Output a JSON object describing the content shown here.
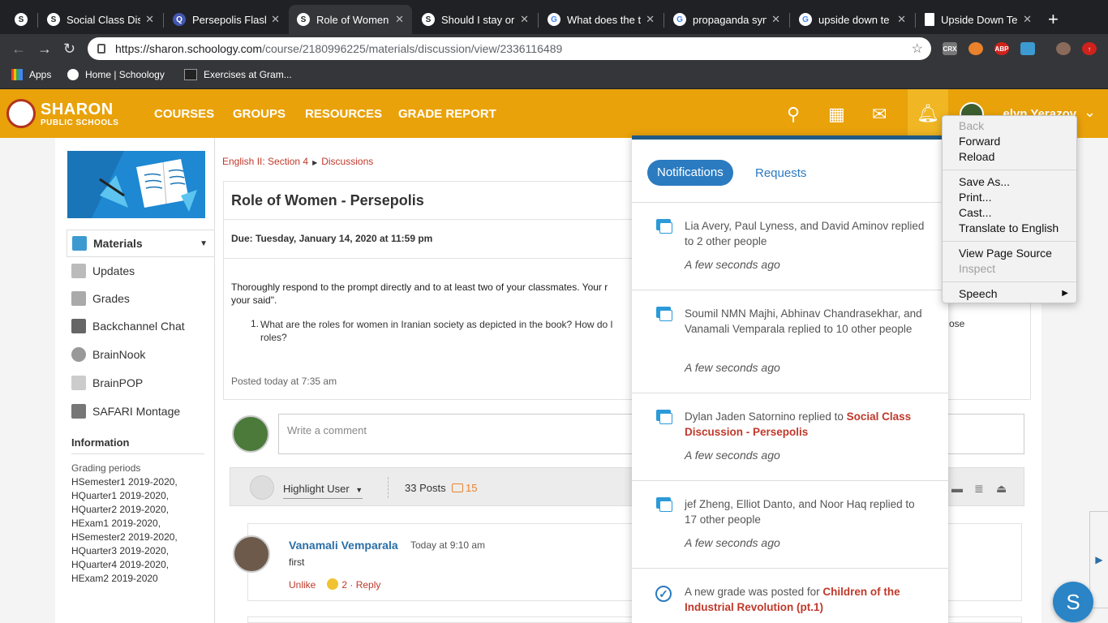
{
  "browser": {
    "tabs": [
      {
        "label": "",
        "icon": "schoology-icon",
        "active": false
      },
      {
        "label": "Social Class Dis",
        "icon": "schoology-icon",
        "active": false
      },
      {
        "label": "Persepolis Flash",
        "icon": "quizlet-icon",
        "active": false
      },
      {
        "label": "Role of Women",
        "icon": "schoology-icon",
        "active": true
      },
      {
        "label": "Should I stay or",
        "icon": "schoology-icon",
        "active": false
      },
      {
        "label": "What does the t",
        "icon": "google-icon",
        "active": false
      },
      {
        "label": "propaganda syn",
        "icon": "google-icon",
        "active": false
      },
      {
        "label": "upside down te",
        "icon": "google-icon",
        "active": false
      },
      {
        "label": "Upside Down Te",
        "icon": "document-icon",
        "active": false
      }
    ],
    "url_host": "https://sharon.schoology.com",
    "url_path": "/course/2180996225/materials/discussion/view/2336116489",
    "extensions": [
      "CRX",
      "ABP"
    ],
    "bookmarks": [
      {
        "label": "Apps"
      },
      {
        "label": "Home | Schoology"
      },
      {
        "label": "Exercises at Gram..."
      }
    ]
  },
  "header": {
    "logo_line1": "SHARON",
    "logo_line2": "PUBLIC SCHOOLS",
    "nav": [
      "COURSES",
      "GROUPS",
      "RESOURCES",
      "GRADE REPORT"
    ],
    "user_name": "...elyn Yerazov",
    "brand_color": "#e9a20a"
  },
  "sidebar": {
    "items": [
      {
        "label": "Materials",
        "selected": true
      },
      {
        "label": "Updates"
      },
      {
        "label": "Grades"
      },
      {
        "label": "Backchannel Chat"
      },
      {
        "label": "BrainNook"
      },
      {
        "label": "BrainPOP"
      },
      {
        "label": "SAFARI Montage"
      }
    ],
    "info_heading": "Information",
    "grading_label": "Grading periods",
    "grading_periods": "HSemester1 2019-2020,\nHQuarter1 2019-2020,\nHQuarter2 2019-2020,\nHExam1 2019-2020,\nHSemester2 2019-2020,\nHQuarter3 2019-2020,\nHQuarter4 2019-2020,\nHExam2 2019-2020"
  },
  "main": {
    "breadcrumb_course": "English II: Section 4",
    "breadcrumb_page": "Discussions",
    "title": "Role of Women - Persepolis",
    "due": "Due: Tuesday, January 14, 2020 at 11:59 pm",
    "prompt": "Thoroughly respond to the prompt directly and to at least two of your classmates. Your r",
    "prompt_tail": "your said\".",
    "question_num": "1.",
    "question": "What are the roles for women in Iranian society as depicted in the book?  How do l",
    "question_tail": "ose",
    "question_line2": "roles?",
    "posted": "Posted today at 7:35 am",
    "comment_placeholder": "Write a comment",
    "highlight_user": "Highlight User",
    "posts_count": "33 Posts",
    "new_count": "15",
    "reply": {
      "name": "Vanamali Vemparala",
      "time": "Today at 9:10 am",
      "body": "first",
      "unlike": "Unlike",
      "likes": "2",
      "reply_label": "· Reply"
    }
  },
  "notifications": {
    "tab_active": "Notifications",
    "tab_other": "Requests",
    "items": [
      {
        "text": "Lia Avery, Paul Lyness, and David Aminov replied to 2 other people",
        "link": "",
        "time": "A few seconds ago"
      },
      {
        "text": "Soumil NMN Majhi, Abhinav Chandrasekhar, and Vanamali Vemparala replied to 10 other people",
        "link": "",
        "time": "A few seconds ago"
      },
      {
        "text": "Dylan Jaden Satornino replied to ",
        "link": "Social Class Discussion - Persepolis",
        "time": "A few seconds ago"
      },
      {
        "text": "jef Zheng, Elliot Danto, and Noor Haq replied to 17 other people",
        "link": "",
        "time": "A few seconds ago"
      },
      {
        "text": "A new grade was posted for ",
        "link": "Children of the Industrial Revolution (pt.1)",
        "time": ""
      }
    ]
  },
  "context_menu": {
    "items": [
      {
        "label": "Back",
        "disabled": true
      },
      {
        "label": "Forward",
        "disabled": false
      },
      {
        "label": "Reload",
        "disabled": false
      },
      {
        "label": "Save As...",
        "disabled": false
      },
      {
        "label": "Print...",
        "disabled": false
      },
      {
        "label": "Cast...",
        "disabled": false
      },
      {
        "label": "Translate to English",
        "disabled": false
      },
      {
        "label": "View Page Source",
        "disabled": false
      },
      {
        "label": "Inspect",
        "disabled": true
      },
      {
        "label": "Speech",
        "disabled": false
      }
    ]
  },
  "chat_bubble_letter": "S"
}
